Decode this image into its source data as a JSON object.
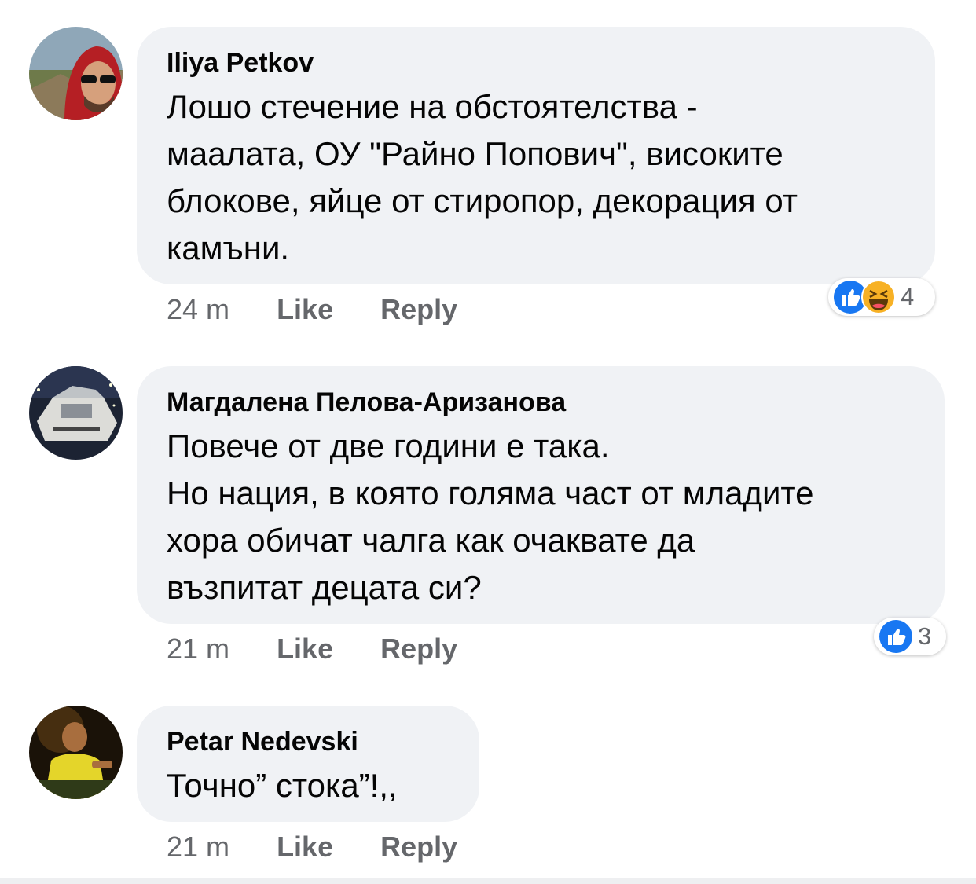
{
  "comments": [
    {
      "author": "Iliya Petkov",
      "text": "Лошо стечение на обстоятелства -\nмаалата, ОУ \"Райно Попович\", високите\nблокове, яйце от стиропор, декорация от\nкамъни.",
      "time": "24 m",
      "like_label": "Like",
      "reply_label": "Reply",
      "reaction_icons": [
        "like-icon",
        "haha-icon"
      ],
      "reaction_count": "4"
    },
    {
      "author": "Магдалена Пелова-Аризанова",
      "text": "Повече от две години е така.\nНо нация, в която голяма част от младите\nхора обичат чалга как очаквате да\nвъзпитат децата си?",
      "time": "21 m",
      "like_label": "Like",
      "reply_label": "Reply",
      "reaction_icons": [
        "like-icon"
      ],
      "reaction_count": "3"
    },
    {
      "author": "Petar Nedevski",
      "text": "Точно” стока”!,,",
      "time": "21 m",
      "like_label": "Like",
      "reply_label": "Reply"
    }
  ],
  "colors": {
    "bubble": "#f0f2f5",
    "meta_text": "#65676b",
    "like_blue": "#1877f2",
    "haha_yellow": "#f7b125"
  }
}
